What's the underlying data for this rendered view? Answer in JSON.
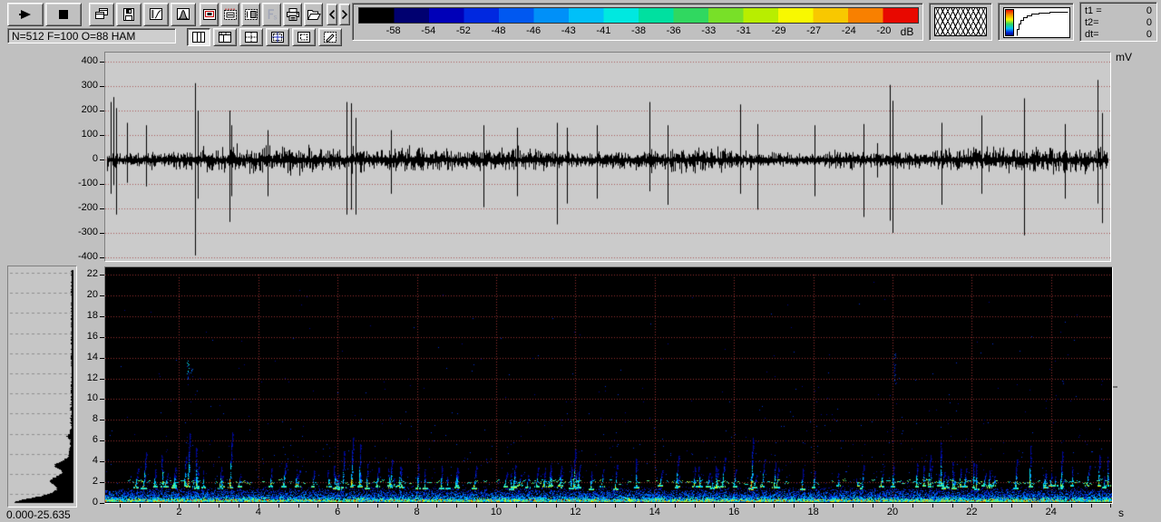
{
  "toolbar": {
    "row1": [
      {
        "name": "play-button",
        "icon": "play-icon",
        "wide": true
      },
      {
        "name": "stop-button",
        "icon": "stop-icon",
        "wide": true
      },
      {
        "name": "cascade-windows-button",
        "icon": "cascade-windows-icon",
        "gap": "gapL"
      },
      {
        "name": "save-button",
        "icon": "floppy-disk-icon"
      },
      {
        "name": "transfer-curve-button",
        "icon": "transfer-curve-icon"
      },
      {
        "name": "window-function-button",
        "icon": "window-function-icon"
      },
      {
        "name": "display-frame-button",
        "icon": "framed-display-icon",
        "gap": "gapS",
        "small": true
      },
      {
        "name": "zoom-frame-button",
        "icon": "dashed-frame-icon",
        "small": true
      },
      {
        "name": "shaded-frame-button",
        "icon": "shaded-frame-icon",
        "small": true
      },
      {
        "name": "sampling-frequency-button",
        "icon": "fs-icon",
        "small": true,
        "disabled": true
      },
      {
        "name": "print-button",
        "icon": "printer-icon",
        "small": true
      },
      {
        "name": "open-file-button",
        "icon": "open-folder-icon",
        "small": true
      },
      {
        "name": "scroll-left-button",
        "icon": "chevron-left-icon",
        "narrow": true,
        "gap": "gapS"
      },
      {
        "name": "scroll-right-button",
        "icon": "chevron-right-icon",
        "narrow": true
      }
    ],
    "status_text": "N=512 F=100 O=88 HAM",
    "row2": [
      {
        "name": "layout-columns-button",
        "icon": "layout-columns-icon",
        "pressed": true
      },
      {
        "name": "layout-top-strip-button",
        "icon": "layout-top-strip-icon"
      },
      {
        "name": "layout-quad-button",
        "icon": "layout-quad-icon"
      },
      {
        "name": "layout-quad-cursor-button",
        "icon": "layout-quad-cursor-icon"
      },
      {
        "name": "layout-inset-button",
        "icon": "layout-inset-icon"
      },
      {
        "name": "layout-edit-button",
        "icon": "layout-edit-icon"
      }
    ]
  },
  "colorbar": {
    "tick_labels": [
      "-58",
      "-54",
      "-52",
      "-48",
      "-46",
      "-43",
      "-41",
      "-38",
      "-36",
      "-33",
      "-31",
      "-29",
      "-27",
      "-24",
      "-20"
    ],
    "unit_label": "dB",
    "segment_colors": [
      "#000000",
      "#000070",
      "#0000b8",
      "#0028e0",
      "#0058f0",
      "#0090f8",
      "#00c0f8",
      "#00e8e0",
      "#00e0a0",
      "#30d860",
      "#78e028",
      "#b8ee00",
      "#f8f800",
      "#f8c800",
      "#f88000",
      "#e80800"
    ]
  },
  "indicator_panels": {
    "overlap_display_name": "window-overlap-display",
    "transfer_display_name": "color-transfer-curve-display"
  },
  "readout": {
    "rows": [
      {
        "label": "t1 =",
        "value": "0"
      },
      {
        "label": "t2=",
        "value": "0"
      },
      {
        "label": "dt=",
        "value": "0"
      }
    ]
  },
  "waveform_plot": {
    "unit_label": "mV",
    "y_tick_labels": [
      "400",
      "300",
      "200",
      "100",
      "0",
      "-100",
      "-200",
      "-300",
      "-400"
    ],
    "y_range_mv": [
      -400,
      400
    ],
    "grid_color": "#a85858",
    "trace_color": "#000000",
    "bg_color": "#cbcbcb"
  },
  "spectrogram_plot": {
    "y_tick_labels": [
      "22",
      "20",
      "18",
      "16",
      "14",
      "12",
      "10",
      "8",
      "6",
      "4",
      "2",
      "0"
    ],
    "x_tick_labels": [
      "2",
      "4",
      "6",
      "8",
      "10",
      "12",
      "14",
      "16",
      "18",
      "20",
      "22",
      "24"
    ],
    "x_unit_label": "s",
    "x_range_s": [
      0,
      25.635
    ],
    "y_range_khz": [
      0,
      22
    ],
    "grid_color": "#9a3030",
    "bg_color": "#000000"
  },
  "spectrum_panel": {
    "range_label": "0.000-25.635"
  }
}
